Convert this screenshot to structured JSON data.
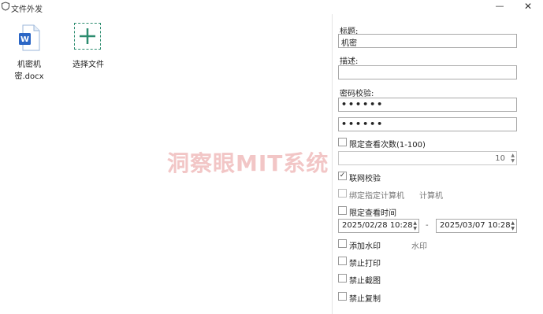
{
  "window": {
    "title": "文件外发",
    "minimize_icon": "minimize-icon",
    "close_icon": "close-icon"
  },
  "files": [
    {
      "name": "机密机密.docx",
      "icon": "word-doc-icon"
    }
  ],
  "add_file": {
    "label": "选择文件",
    "icon": "plus-icon",
    "accent": "#2c8c6f"
  },
  "watermark_text": "洞察眼MIT系统",
  "form": {
    "title_label": "标题:",
    "title_value": "机密",
    "desc_label": "描述:",
    "desc_value": "",
    "password_label": "密码校验:",
    "password_value": "••••••",
    "password_confirm_value": "••••••",
    "limit_views": {
      "label": "限定查看次数(1-100)",
      "checked": false,
      "value": "10"
    },
    "network_check": {
      "label": "联网校验",
      "checked": true,
      "mark": "✓"
    },
    "bind_computer": {
      "label": "绑定指定计算机",
      "checked": false,
      "side_text": "计算机"
    },
    "limit_time": {
      "label": "限定查看时间",
      "checked": false
    },
    "time_start": "2025/02/28 10:28",
    "time_sep": "-",
    "time_end": "2025/03/07 10:28",
    "add_watermark": {
      "label": "添加水印",
      "checked": false,
      "side_text": "水印"
    },
    "no_print": {
      "label": "禁止打印",
      "checked": false
    },
    "no_screenshot": {
      "label": "禁止截图",
      "checked": false
    },
    "no_copy": {
      "label": "禁止复制",
      "checked": false
    }
  }
}
